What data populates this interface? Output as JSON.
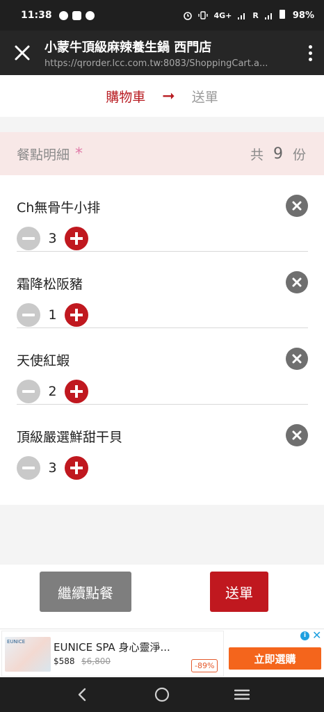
{
  "status_bar": {
    "time": "11:38",
    "network_label": "4G+",
    "roaming": "R",
    "battery": "98%"
  },
  "app_bar": {
    "title": "小蒙牛頂級麻辣養生鍋 西門店",
    "url": "https://qrorder.lcc.com.tw:8083/ShoppingCart.a..."
  },
  "steps": {
    "current": "購物車",
    "arrow": "➞",
    "next": "送單"
  },
  "summary": {
    "label": "餐點明細",
    "star": "*",
    "prefix": "共",
    "count": "9",
    "suffix": "份"
  },
  "cart_items": [
    {
      "name": "Ch無骨牛小排",
      "qty": "3"
    },
    {
      "name": "霜降松阪豬",
      "qty": "1"
    },
    {
      "name": "天使紅蝦",
      "qty": "2"
    },
    {
      "name": "頂級嚴選鮮甜干貝",
      "qty": "3"
    }
  ],
  "actions": {
    "continue_label": "繼續點餐",
    "submit_label": "送單"
  },
  "ad": {
    "thumb_label": "EUNICE",
    "title": "EUNICE SPA 身心靈淨...",
    "price": "$588",
    "old_price": "$6,800",
    "discount": "-89%",
    "cta": "立即選購",
    "info_icon": "i",
    "close_icon": "✕"
  },
  "icons": {
    "close": "close-icon",
    "menu": "more-vertical-icon",
    "remove": "remove-circle-icon",
    "minus": "minus-circle-icon",
    "plus": "plus-circle-icon",
    "back": "back-icon",
    "home": "home-icon",
    "recents": "recents-icon"
  },
  "colors": {
    "brand_red": "#c0181f",
    "section_bg": "#f8e8e7",
    "grey_button": "#7e7e7e",
    "ad_cta": "#f4651c"
  }
}
